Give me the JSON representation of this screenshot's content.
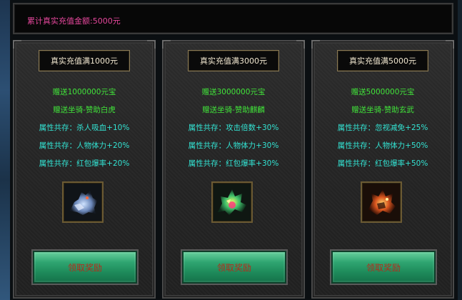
{
  "header": {
    "total_recharge_text": "累计真实充值金额:5000元"
  },
  "cards": [
    {
      "title": "真实充值满1000元",
      "gold": "赠送1000000元宝",
      "mount": "赠送坐骑-赞助白虎",
      "attrs": [
        "属性共存：杀人吸血+10%",
        "属性共存：人物体力+20%",
        "属性共存：红包爆率+20%"
      ],
      "reward_icon": "white-tiger-mount-icon",
      "button_label": "领取奖励"
    },
    {
      "title": "真实充值满3000元",
      "gold": "赠送3000000元宝",
      "mount": "赠送坐骑-赞助麒麟",
      "attrs": [
        "属性共存：攻击倍数+30%",
        "属性共存：人物体力+30%",
        "属性共存：红包爆率+30%"
      ],
      "reward_icon": "qilin-mount-icon",
      "button_label": "领取奖励"
    },
    {
      "title": "真实充值满5000元",
      "gold": "赠送5000000元宝",
      "mount": "赠送坐骑-赞助玄武",
      "attrs": [
        "属性共存：忽视减免+25%",
        "属性共存：人物体力+50%",
        "属性共存：红包爆率+50%"
      ],
      "reward_icon": "xuanwu-mount-icon",
      "button_label": "领取奖励"
    }
  ],
  "colors": {
    "header_text": "#e6479c",
    "reward_text": "#41e43a",
    "attr_text": "#33e3d3",
    "button_text": "#b52b1a",
    "button_green": "#2fa571"
  }
}
